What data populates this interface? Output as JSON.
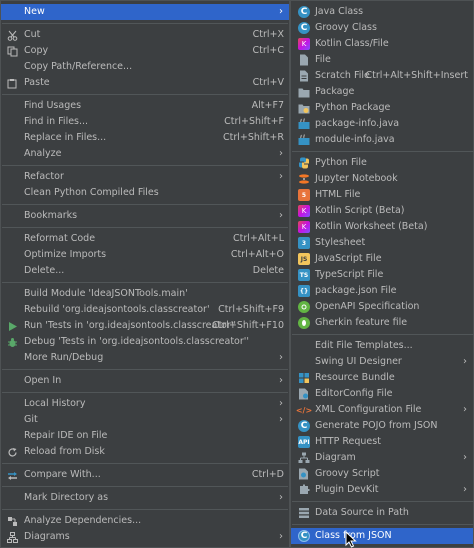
{
  "context_menu": {
    "new": {
      "label": "New"
    },
    "cut": {
      "label": "Cut",
      "shortcut": "Ctrl+X"
    },
    "copy": {
      "label": "Copy",
      "shortcut": "Ctrl+C"
    },
    "copy_path": {
      "label": "Copy Path/Reference..."
    },
    "paste": {
      "label": "Paste",
      "shortcut": "Ctrl+V"
    },
    "find_usages": {
      "label": "Find Usages",
      "shortcut": "Alt+F7"
    },
    "find_in_files": {
      "label": "Find in Files...",
      "shortcut": "Ctrl+Shift+F"
    },
    "replace_in_files": {
      "label": "Replace in Files...",
      "shortcut": "Ctrl+Shift+R"
    },
    "analyze": {
      "label": "Analyze"
    },
    "refactor": {
      "label": "Refactor"
    },
    "clean_python": {
      "label": "Clean Python Compiled Files"
    },
    "bookmarks": {
      "label": "Bookmarks"
    },
    "reformat": {
      "label": "Reformat Code",
      "shortcut": "Ctrl+Alt+L"
    },
    "optimize": {
      "label": "Optimize Imports",
      "shortcut": "Ctrl+Alt+O"
    },
    "delete": {
      "label": "Delete...",
      "shortcut": "Delete"
    },
    "build_module": {
      "label": "Build Module 'IdeaJSONTools.main'"
    },
    "rebuild": {
      "label": "Rebuild 'org.ideajsontools.classcreator'",
      "shortcut": "Ctrl+Shift+F9"
    },
    "run": {
      "label": "Run 'Tests in 'org.ideajsontools.classcreator''",
      "shortcut": "Ctrl+Shift+F10"
    },
    "debug": {
      "label": "Debug 'Tests in 'org.ideajsontools.classcreator''"
    },
    "more_run": {
      "label": "More Run/Debug"
    },
    "open_in": {
      "label": "Open In"
    },
    "local_history": {
      "label": "Local History"
    },
    "git": {
      "label": "Git"
    },
    "repair_ide": {
      "label": "Repair IDE on File"
    },
    "reload": {
      "label": "Reload from Disk"
    },
    "compare": {
      "label": "Compare With...",
      "shortcut": "Ctrl+D"
    },
    "mark_dir": {
      "label": "Mark Directory as"
    },
    "analyze_deps": {
      "label": "Analyze Dependencies..."
    },
    "diagrams": {
      "label": "Diagrams"
    }
  },
  "submenu": {
    "java_class": "Java Class",
    "groovy_class": "Groovy Class",
    "kotlin_class": "Kotlin Class/File",
    "file": "File",
    "scratch_file": {
      "label": "Scratch File",
      "shortcut": "Ctrl+Alt+Shift+Insert"
    },
    "package": "Package",
    "python_package": "Python Package",
    "package_info": "package-info.java",
    "module_info": "module-info.java",
    "python_file": "Python File",
    "jupyter": "Jupyter Notebook",
    "html_file": "HTML File",
    "kotlin_script": "Kotlin Script (Beta)",
    "kotlin_worksheet": "Kotlin Worksheet (Beta)",
    "stylesheet": "Stylesheet",
    "js_file": "JavaScript File",
    "ts_file": "TypeScript File",
    "package_json": "package.json File",
    "openapi": "OpenAPI Specification",
    "gherkin": "Gherkin feature file",
    "edit_templates": "Edit File Templates...",
    "swing_designer": "Swing UI Designer",
    "resource_bundle": "Resource Bundle",
    "editorconfig": "EditorConfig File",
    "xml_config": "XML Configuration File",
    "gen_pojo": "Generate POJO from JSON",
    "http_request": "HTTP Request",
    "diagram": "Diagram",
    "groovy_script": "Groovy Script",
    "plugin_devkit": "Plugin DevKit",
    "data_source": "Data Source in Path",
    "class_from_json": "Class from JSON"
  },
  "icons": {
    "cut": "scissors-icon",
    "copy": "copy-icon",
    "paste": "paste-icon",
    "refactor": "refactor-icon",
    "run": "run-icon",
    "debug": "debug-icon",
    "reload": "reload-icon",
    "compare": "compare-icon",
    "analyze": "dependencies-icon",
    "diagrams": "diagram-icon"
  },
  "colors": {
    "menu_bg": "#3c3f41",
    "selection": "#2f65ca",
    "text": "#bbbbbb",
    "separator": "#515658"
  }
}
